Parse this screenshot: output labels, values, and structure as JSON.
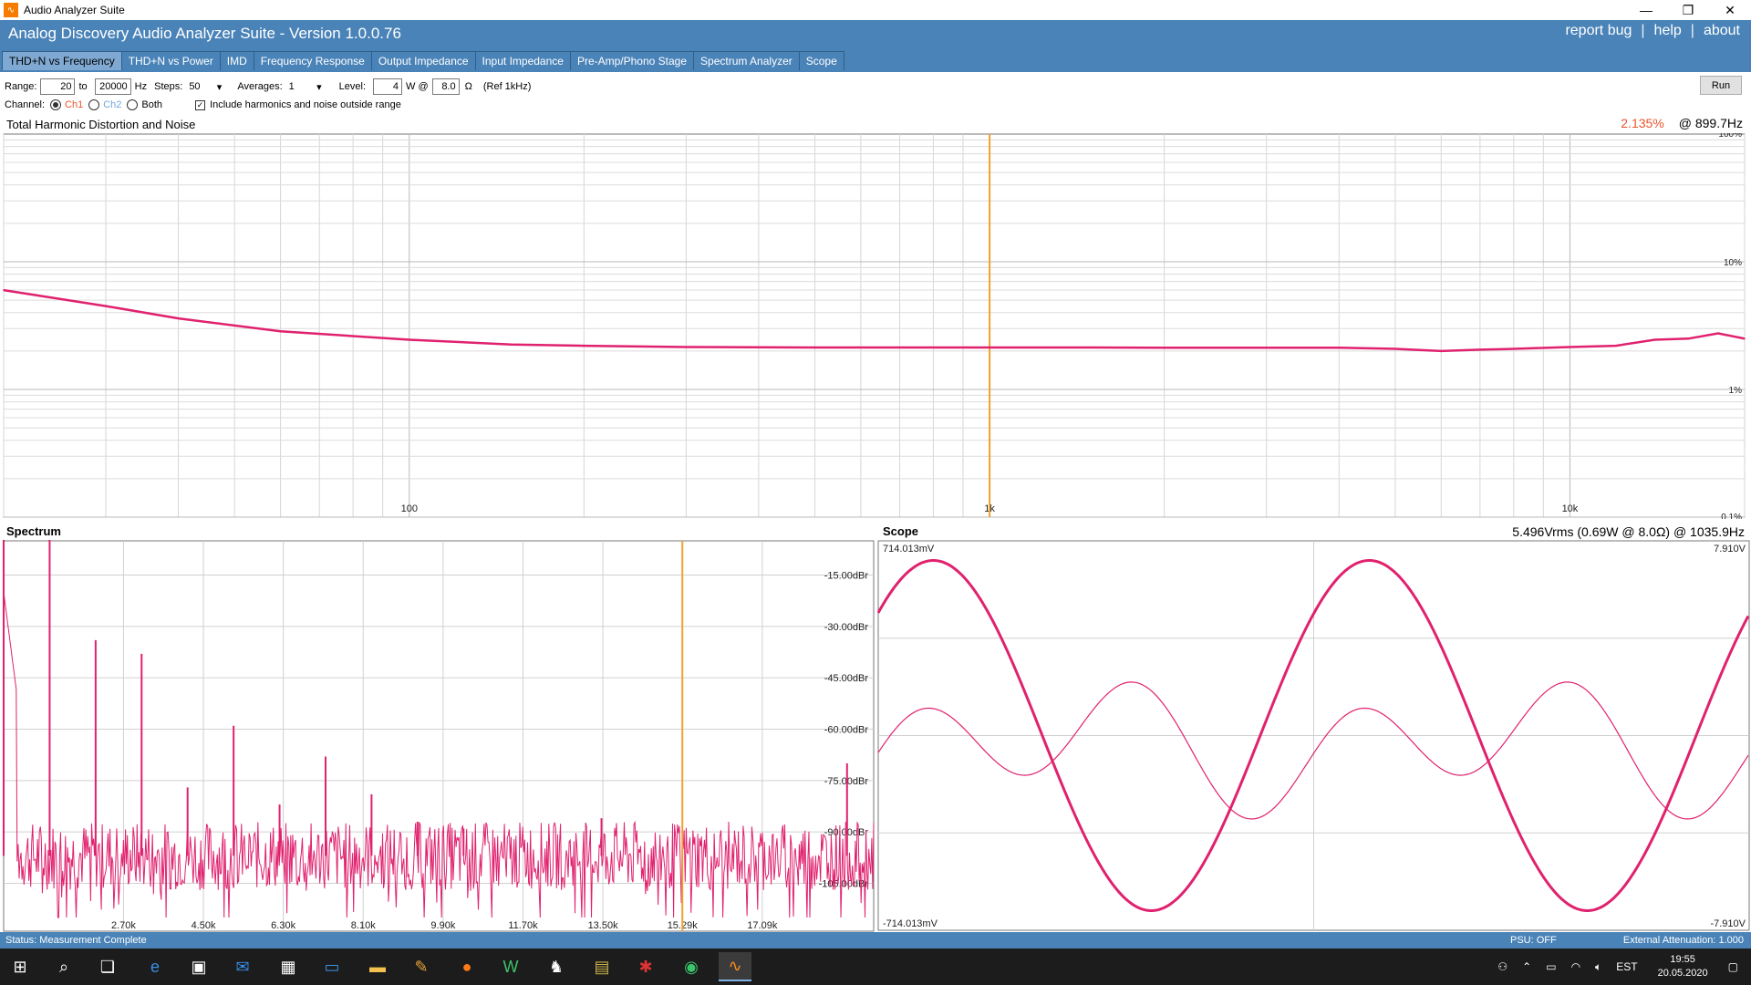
{
  "window": {
    "title": "Audio Analyzer Suite",
    "minimize": "—",
    "restore": "❐",
    "close": "✕"
  },
  "header": {
    "app_title": "Analog Discovery Audio Analyzer Suite - Version   1.0.0.76",
    "links": [
      "report bug",
      "help",
      "about"
    ],
    "separator": "|"
  },
  "tabs": [
    {
      "label": "THD+N vs Frequency",
      "active": true
    },
    {
      "label": "THD+N vs Power",
      "active": false
    },
    {
      "label": "IMD",
      "active": false
    },
    {
      "label": "Frequency Response",
      "active": false
    },
    {
      "label": "Output Impedance",
      "active": false
    },
    {
      "label": "Input Impedance",
      "active": false
    },
    {
      "label": "Pre-Amp/Phono Stage",
      "active": false
    },
    {
      "label": "Spectrum Analyzer",
      "active": false
    },
    {
      "label": "Scope",
      "active": false
    }
  ],
  "controls": {
    "range_label": "Range:",
    "range_from": "20",
    "to_label": "to",
    "range_to": "20000",
    "hz_label": "Hz",
    "steps_label": "Steps:",
    "steps_value": "50",
    "averages_label": "Averages:",
    "averages_value": "1",
    "level_label": "Level:",
    "level_value": "4",
    "w_at_label": "W @",
    "ohm_value": "8.0",
    "ohm_unit": "Ω",
    "ref_label": "(Ref 1kHz)",
    "channel_label": "Channel:",
    "ch1": "Ch1",
    "ch2": "Ch2",
    "both": "Both",
    "include_label": "Include harmonics and noise outside range",
    "run_label": "Run"
  },
  "thd": {
    "title": "Total Harmonic Distortion and Noise",
    "readout_pct": "2.135%",
    "readout_freq": "@ 899.7Hz",
    "x_ticks": [
      {
        "f": 100,
        "label": "100"
      },
      {
        "f": 1000,
        "label": "1k"
      },
      {
        "f": 10000,
        "label": "10k"
      }
    ],
    "y_labels": [
      {
        "v": 100,
        "label": "100%"
      },
      {
        "v": 10,
        "label": "10%"
      },
      {
        "v": 1,
        "label": "1%"
      },
      {
        "v": 0.1,
        "label": "0.1%"
      }
    ],
    "cursor_freq": 1000
  },
  "spectrum": {
    "title": "Spectrum",
    "x_labels": [
      "2.70k",
      "4.50k",
      "6.30k",
      "8.10k",
      "9.90k",
      "11.70k",
      "13.50k",
      "15.29k",
      "17.09k"
    ],
    "y_labels": [
      "-15.00dBr",
      "-30.00dBr",
      "-45.00dBr",
      "-60.00dBr",
      "-75.00dBr",
      "-90.00dBr",
      "-105.00dBr"
    ]
  },
  "scope": {
    "title": "Scope",
    "readout": "5.496Vrms (0.69W @ 8.0Ω) @ 1035.9Hz",
    "left_top": "714.013mV",
    "left_bottom": "-714.013mV",
    "right_top": "7.910V",
    "right_bottom": "-7.910V"
  },
  "status": {
    "text": "Status: Measurement Complete",
    "psu": "PSU: OFF",
    "attenuation": "External Attenuation: 1.000"
  },
  "taskbar": {
    "lang": "EST",
    "time": "19:55",
    "date": "20.05.2020"
  },
  "chart_data": [
    {
      "type": "line",
      "title": "Total Harmonic Distortion and Noise",
      "x_scale": "log",
      "y_scale": "log",
      "x": [
        20,
        30,
        40,
        60,
        100,
        150,
        200,
        300,
        500,
        700,
        1000,
        1500,
        2000,
        3000,
        4000,
        5000,
        6000,
        7000,
        8000,
        10000,
        12000,
        14000,
        16000,
        18000,
        20000
      ],
      "series": [
        {
          "values": [
            6.0,
            4.5,
            3.6,
            2.85,
            2.45,
            2.25,
            2.2,
            2.15,
            2.13,
            2.13,
            2.13,
            2.13,
            2.12,
            2.12,
            2.12,
            2.08,
            2.0,
            2.05,
            2.08,
            2.15,
            2.2,
            2.45,
            2.5,
            2.75,
            2.5
          ]
        }
      ],
      "xlim": [
        20,
        20000
      ],
      "ylim": [
        0.1,
        100
      ],
      "color": "#e0216e",
      "cursor_color": "#f0a030"
    },
    {
      "type": "line",
      "title": "Spectrum",
      "x_unit": "Hz",
      "y_unit": "dBr",
      "ylim": [
        -115,
        -5
      ],
      "noise_floor": -97,
      "peaks": [
        {
          "x": 0,
          "y": -3
        },
        {
          "x": 1036,
          "y": -3
        },
        {
          "x": 2072,
          "y": -34
        },
        {
          "x": 3108,
          "y": -38
        },
        {
          "x": 4144,
          "y": -77
        },
        {
          "x": 5180,
          "y": -59
        },
        {
          "x": 6216,
          "y": -82
        },
        {
          "x": 7252,
          "y": -68
        },
        {
          "x": 8288,
          "y": -79
        },
        {
          "x": 9324,
          "y": -87
        },
        {
          "x": 10360,
          "y": -89
        },
        {
          "x": 13468,
          "y": -86
        },
        {
          "x": 19000,
          "y": -70
        }
      ],
      "color": "#e0216e",
      "cursor_color": "#f0a030"
    },
    {
      "type": "line",
      "title": "Scope",
      "series": [
        {
          "name": "",
          "amplitude_v": 7.91,
          "frequency_hz": 1035.9
        },
        {
          "name": "",
          "shape": "distortion residual"
        }
      ],
      "ylim_left": [
        -714.013,
        714.013
      ],
      "ylim_right": [
        -7.91,
        7.91
      ],
      "color": "#e0216e"
    }
  ]
}
